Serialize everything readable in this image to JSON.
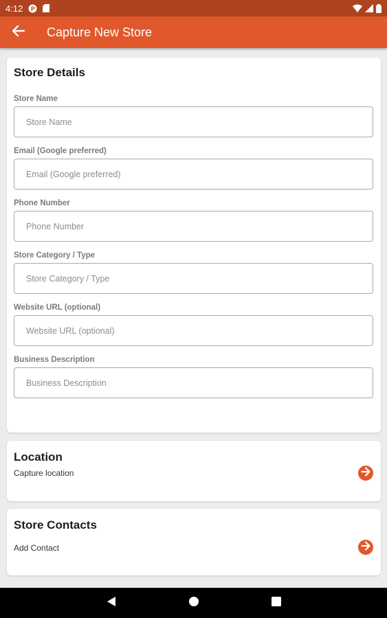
{
  "status_bar": {
    "time": "4:12",
    "icons": [
      "p-badge-icon",
      "sd-card-icon",
      "wifi-icon",
      "signal-icon",
      "battery-icon"
    ],
    "color": "#b0431f"
  },
  "app_bar": {
    "title": "Capture New Store",
    "back_icon": "arrow-left-icon",
    "color": "#e0582b"
  },
  "store_details": {
    "title": "Store Details",
    "fields": [
      {
        "label": "Store Name",
        "placeholder": "Store Name",
        "value": ""
      },
      {
        "label": "Email (Google preferred)",
        "placeholder": "Email (Google preferred)",
        "value": ""
      },
      {
        "label": "Phone Number",
        "placeholder": "Phone Number",
        "value": ""
      },
      {
        "label": "Store Category / Type",
        "placeholder": "Store Category / Type",
        "value": ""
      },
      {
        "label": "Website URL (optional)",
        "placeholder": "Website URL (optional)",
        "value": ""
      },
      {
        "label": "Business Description",
        "placeholder": "Business Description",
        "value": ""
      }
    ]
  },
  "location": {
    "title": "Location",
    "subtitle": "Capture location",
    "icon": "arrow-circle-right-icon"
  },
  "store_contacts": {
    "title": "Store Contacts",
    "subtitle": "Add Contact",
    "icon": "arrow-circle-right-icon"
  },
  "nav_bar": {
    "buttons": [
      "back-triangle-icon",
      "home-circle-icon",
      "recents-square-icon"
    ]
  },
  "accent_color": "#e0582b"
}
